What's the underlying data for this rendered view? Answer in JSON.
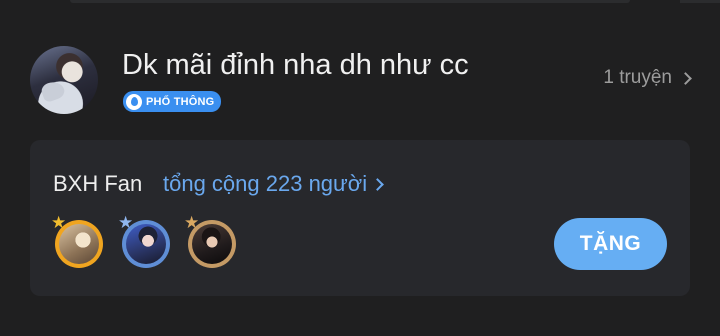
{
  "author": {
    "name": "Dk mãi đỉnh nha dh như cc",
    "badge": "PHỔ THÔNG",
    "works": "1 truyện"
  },
  "fan_board": {
    "title": "BXH Fan",
    "total": "tổng cộng 223 người",
    "gift_label": "TẶNG",
    "fans": [
      {
        "rank": 1,
        "frame_color": "#f0a520"
      },
      {
        "rank": 2,
        "frame_color": "#5f8ed6"
      },
      {
        "rank": 3,
        "frame_color": "#c49a65"
      }
    ]
  },
  "colors": {
    "background": "#1f1f20",
    "card": "#27282c",
    "accent": "#66aef3",
    "link": "#6aa8ee",
    "badge": "#3a8ff0"
  },
  "icons": [
    "chevron-right-icon",
    "crown-icon",
    "level-drop-icon"
  ]
}
